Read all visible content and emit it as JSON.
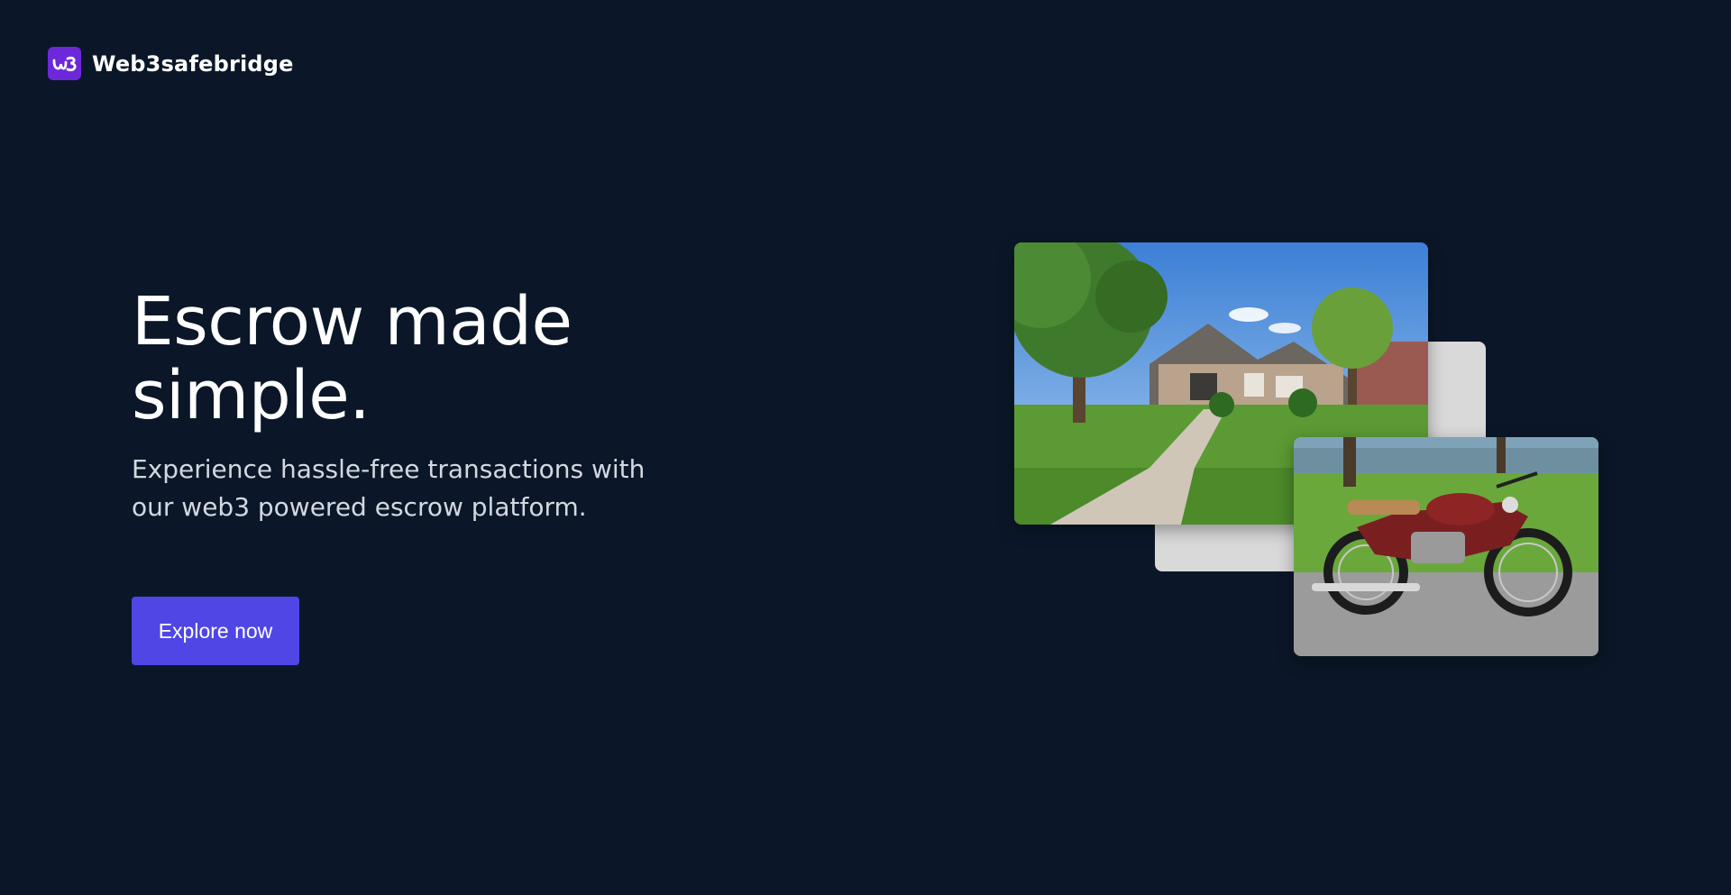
{
  "brand": {
    "logo_text": "ω3",
    "name": "Web3safebridge",
    "logo_color": "#6d28d9"
  },
  "hero": {
    "title": "Escrow made simple.",
    "subtitle": "Experience hassle-free transactions with our web3 powered escrow platform.",
    "cta_label": "Explore now"
  },
  "colors": {
    "background": "#0b1728",
    "accent": "#4f46e5"
  }
}
